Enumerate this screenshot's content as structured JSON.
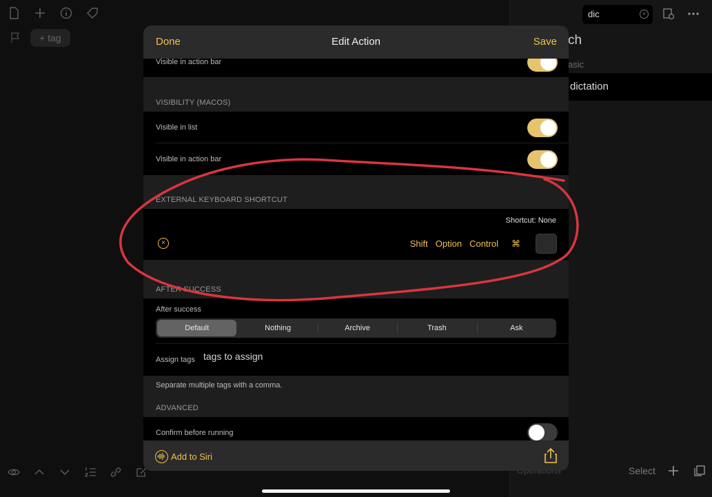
{
  "background": {
    "tag_pill": "+ tag",
    "search_value": "dic",
    "peek_title": "ch",
    "peek_subtitle": "asic",
    "peek_item": "dictation",
    "operations_label": "Operations",
    "select_label": "Select"
  },
  "modal": {
    "header": {
      "done": "Done",
      "title": "Edit Action",
      "save": "Save"
    },
    "visible_action_bar_top": "Visible in action bar",
    "visibility_macos": {
      "heading": "VISIBILITY (MACOS)",
      "visible_in_list": "Visible in list",
      "visible_in_action_bar": "Visible in action bar"
    },
    "keyboard": {
      "heading": "EXTERNAL KEYBOARD SHORTCUT",
      "shortcut_status": "Shortcut: None",
      "shift": "Shift",
      "option": "Option",
      "control": "Control",
      "command": "⌘"
    },
    "after_success": {
      "heading": "AFTER SUCCESS",
      "label": "After success",
      "options": [
        "Default",
        "Nothing",
        "Archive",
        "Trash",
        "Ask"
      ],
      "selected": "Default",
      "assign_tags_label": "Assign tags",
      "assign_tags_placeholder": "tags to assign",
      "help": "Separate multiple tags with a comma."
    },
    "advanced": {
      "heading": "ADVANCED",
      "confirm": "Confirm before running"
    },
    "footer": {
      "add_to_siri": "Add to Siri"
    }
  },
  "colors": {
    "accent": "#f2c14e",
    "toggle_on": "#e6c46d",
    "annotation": "#d9363e"
  }
}
